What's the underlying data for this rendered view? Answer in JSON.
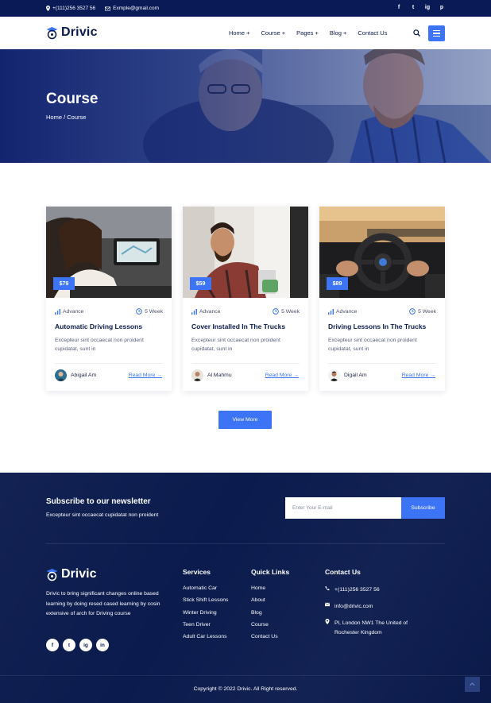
{
  "topbar": {
    "phone": "+(111)256 3527 56",
    "email": "Exmple@gmail.com",
    "social": [
      "f",
      "t",
      "ig",
      "p"
    ]
  },
  "brand": {
    "name": "Drivic"
  },
  "nav": {
    "items": [
      "Home +",
      "Course +",
      "Pages +",
      "Blog +",
      "Contact Us"
    ]
  },
  "hero": {
    "title": "Course",
    "breadcrumb": "Home / Course"
  },
  "courses": [
    {
      "price": "$79",
      "level": "Advance",
      "duration": "5 Week",
      "title": "Automatic Driving Lessons",
      "description": "Excepteur sint occaecat non proident cupidatat, sunt in",
      "author": "Abigail Am",
      "link": "Read More →"
    },
    {
      "price": "$59",
      "level": "Advance",
      "duration": "5 Week",
      "title": "Cover Installed In The Trucks",
      "description": "Excepteur sint occaecat non proident cupidatat, sunt in",
      "author": "Al Mahmu",
      "link": "Read More →"
    },
    {
      "price": "$89",
      "level": "Advance",
      "duration": "5 Week",
      "title": "Driving Lessons In The Trucks",
      "description": "Excepteur sint occaecat non proident cupidatat, sunt in",
      "author": "Digail Am",
      "link": "Read More →"
    }
  ],
  "view_more": "View More",
  "newsletter": {
    "title": "Subscribe to our newsletter",
    "subtitle": "Excepteur sint occaecat cupidatat non proident",
    "placeholder": "Enter Your E-mail",
    "button": "Subscribe"
  },
  "footer": {
    "about": "Drivic to bring significant changes online based learning by doing resed cased learning by cosin extensive of arch for Driving course",
    "social": [
      "f",
      "t",
      "ig",
      "in"
    ],
    "services": {
      "title": "Services",
      "items": [
        "Automatic Car",
        "Stick Shift Lessons",
        "Winter Driving",
        "Teen Driver",
        "Adult Car Lessons"
      ]
    },
    "quick_links": {
      "title": "Quick Links",
      "items": [
        "Home",
        "About",
        "Blog",
        "Course",
        "Contact Us"
      ]
    },
    "contact": {
      "title": "Contact Us",
      "phone": "+(111)256 3527 56",
      "email": "info@drivic.com",
      "address": "Pl, London NW1 The United of Rochester Kingdom"
    },
    "copyright": "Copyright © 2022 Drivic. All Right reserved."
  },
  "colors": {
    "accent": "#3d73f5",
    "navy": "#0b1b4d",
    "topbar": "#0a1a56"
  }
}
